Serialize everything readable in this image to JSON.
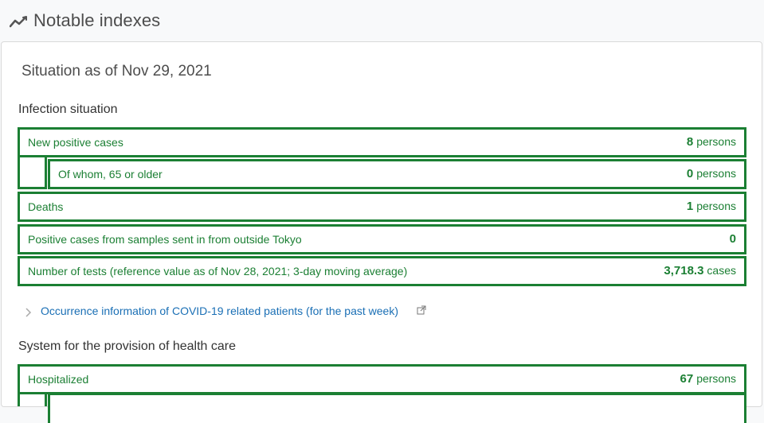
{
  "header": {
    "title": "Notable indexes",
    "icon": "trending-line-icon"
  },
  "card": {
    "situation_label": "Situation as of Nov 29, 2021",
    "infection": {
      "title": "Infection situation",
      "rows": [
        {
          "label": "New positive cases",
          "value": "8",
          "unit": "persons"
        },
        {
          "label": "Of whom, 65 or older",
          "value": "0",
          "unit": "persons"
        },
        {
          "label": "Deaths",
          "value": "1",
          "unit": "persons"
        },
        {
          "label": "Positive cases from samples sent in from outside Tokyo",
          "value": "0",
          "unit": ""
        },
        {
          "label": "Number of tests (reference value as of Nov 28, 2021; 3-day moving average)",
          "value": "3,718.3",
          "unit": "cases"
        }
      ]
    },
    "occurrence_link": {
      "text": "Occurrence information of COVID-19 related patients (for the past week)",
      "icon": "external-link-icon"
    },
    "health_care": {
      "title": "System for the provision of health care",
      "rows": [
        {
          "label": "Hospitalized",
          "value": "67",
          "unit": "persons"
        }
      ]
    }
  },
  "colors": {
    "accent_green": "#1b7f33",
    "link_blue": "#1a6fb5"
  }
}
